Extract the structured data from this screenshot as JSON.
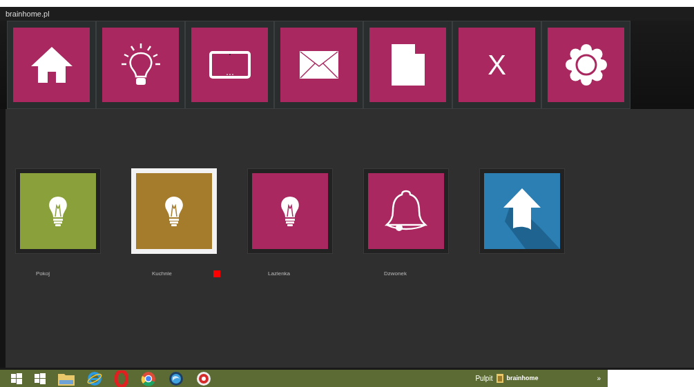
{
  "window": {
    "title": "brainhome.pl"
  },
  "nav": [
    {
      "kind": "home"
    },
    {
      "kind": "light"
    },
    {
      "kind": "tablet"
    },
    {
      "kind": "mail"
    },
    {
      "kind": "document"
    },
    {
      "kind": "text",
      "label": "X"
    },
    {
      "kind": "settings"
    }
  ],
  "devices": [
    {
      "kind": "light",
      "name": "Pokoj",
      "color": "#8aa03a",
      "selected": false,
      "alarm": false
    },
    {
      "kind": "light",
      "name": "Kuchnie",
      "color": "#a57b2c",
      "selected": true,
      "alarm": true
    },
    {
      "kind": "light",
      "name": "Lazienka",
      "color": "#a8285f",
      "selected": false,
      "alarm": false
    },
    {
      "kind": "bell",
      "name": "Dzwonek",
      "color": "#a8285f",
      "selected": false,
      "alarm": false
    },
    {
      "kind": "back",
      "color": "#2b7fb3",
      "selected": false,
      "alarm": false
    }
  ],
  "taskbar": {
    "apps": [
      {
        "kind": "start"
      },
      {
        "kind": "start"
      },
      {
        "kind": "folder"
      },
      {
        "kind": "browser"
      },
      {
        "kind": "oval"
      },
      {
        "kind": "chrome"
      },
      {
        "kind": "globe"
      },
      {
        "kind": "badge"
      }
    ],
    "toolbar_label": "Pulpit",
    "window_label": "brainhome",
    "more": "»"
  }
}
